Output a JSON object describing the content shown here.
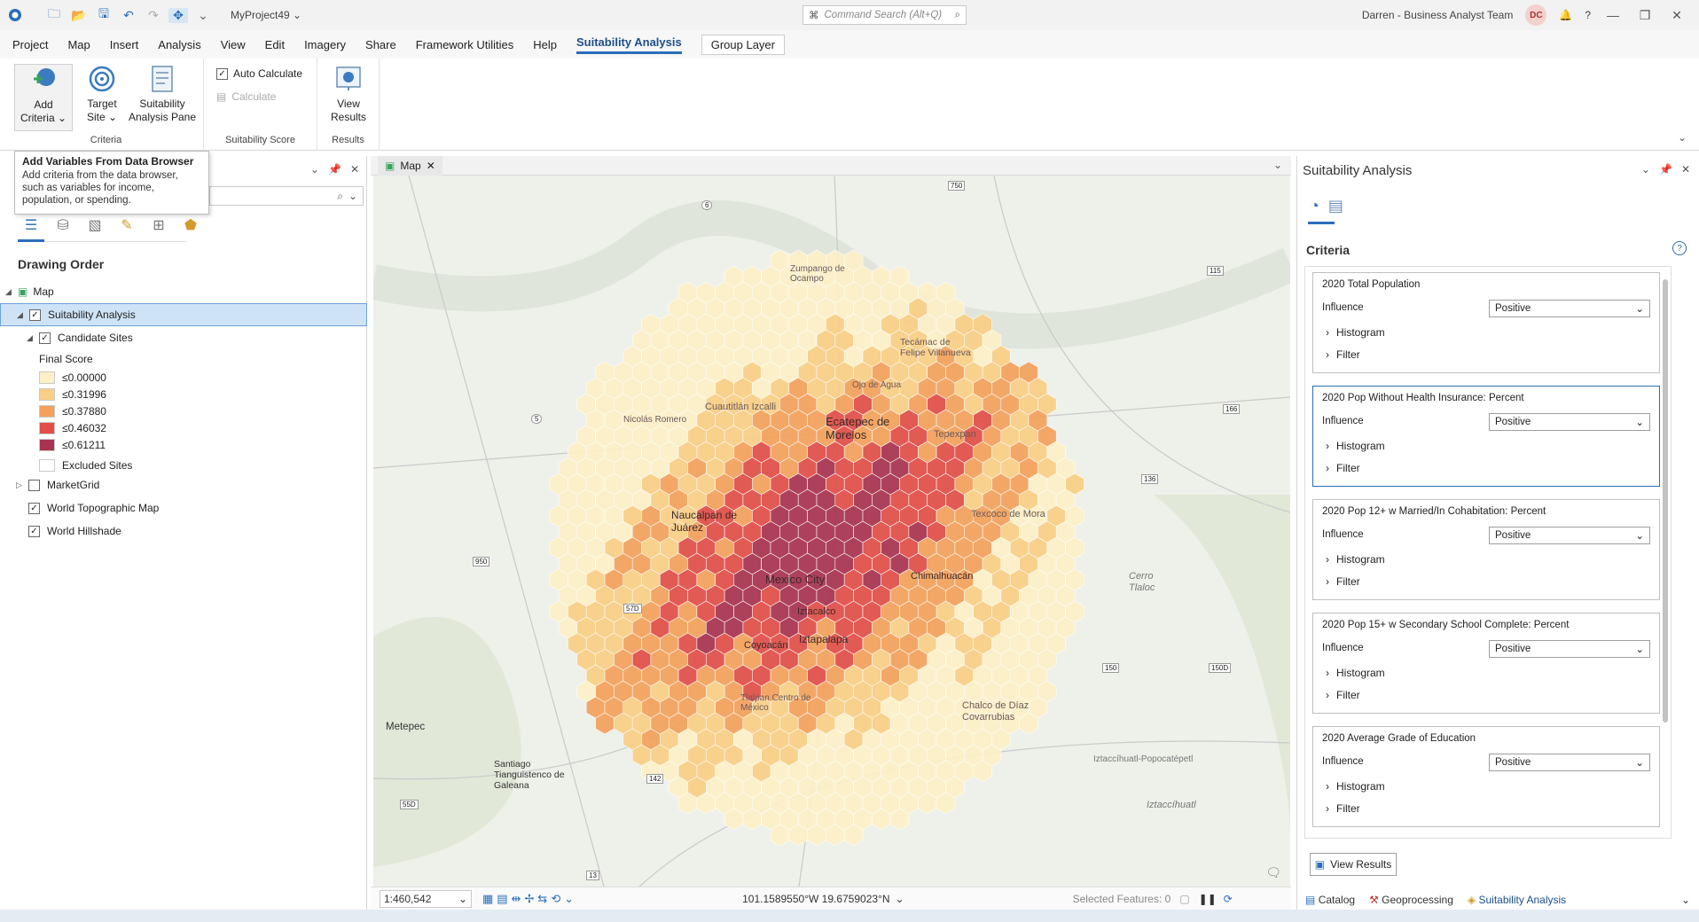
{
  "titlebar": {
    "project_name": "MyProject49 ⌄",
    "search_placeholder": "Command Search (Alt+Q)",
    "user": "Darren - Business Analyst Team",
    "avatar_initials": "DC"
  },
  "menu": {
    "items": [
      "Project",
      "Map",
      "Insert",
      "Analysis",
      "View",
      "Edit",
      "Imagery",
      "Share",
      "Framework Utilities",
      "Help"
    ],
    "active_tab": "Suitability Analysis",
    "context_tab": "Group Layer"
  },
  "ribbon": {
    "add_criteria": "Add",
    "add_criteria2": "Criteria",
    "target_site": "Target",
    "target_site2": "Site",
    "suit_pane": "Suitability",
    "suit_pane2": "Analysis Pane",
    "group_criteria": "Criteria",
    "auto_calc": "Auto Calculate",
    "calculate": "Calculate",
    "group_score": "Suitability Score",
    "view_results": "View",
    "view_results2": "Results",
    "group_results": "Results"
  },
  "tooltip": {
    "title": "Add Variables From Data Browser",
    "body": "Add criteria from the data browser, such as variables for income, population, or spending."
  },
  "contents": {
    "drawing_order": "Drawing Order",
    "map": "Map",
    "suitability": "Suitability Analysis",
    "candidate_sites": "Candidate Sites",
    "final_score": "Final Score",
    "legend": [
      {
        "label": "≤0.00000",
        "color": "#fdf0c8"
      },
      {
        "label": "≤0.31996",
        "color": "#f9cf86"
      },
      {
        "label": "≤0.37880",
        "color": "#f4a15b"
      },
      {
        "label": "≤0.46032",
        "color": "#e24e48"
      },
      {
        "label": "≤0.61211",
        "color": "#a8334f"
      }
    ],
    "excluded": "Excluded Sites",
    "market_grid": "MarketGrid",
    "topo": "World Topographic Map",
    "hillshade": "World Hillshade"
  },
  "map": {
    "tab": "Map",
    "scale": "1:460,542",
    "coords": "101.1589550°W 19.6759023°N",
    "selected": "Selected Features: 0",
    "places": {
      "zumpango": "Zumpango de Ocampo",
      "tecamac": "Tecámac de Felipe Villanueva",
      "ojo": "Ojo de Agua",
      "ecatepec": "Ecatepec de Morelos",
      "cuautitlan": "Cuautitlán Izcalli",
      "nicolas": "Nicolás Romero",
      "tepexpan": "Tepexpan",
      "naucalpan": "Naucalpan de Juárez",
      "texcoco": "Texcoco de Mora",
      "mexico": "Mexico City",
      "chimalhuacan": "Chimalhuacán",
      "iztacalco": "Iztacalco",
      "coyoacan": "Coyoacán",
      "iztapalapa": "Iztapalapa",
      "tlalpan": "Tlalpan Centro de México",
      "chalco": "Chalco de Díaz Covarrubias",
      "metepec": "Metepec",
      "santiago": "Santiago Tianguistenco de Galeana",
      "cerro": "Cerro Tlaloc",
      "izta_popo": "Iztaccíhuatl-Popocatépetl",
      "iztaccihuatl": "Iztaccíhuatl"
    },
    "roads": [
      "750",
      "6",
      "115",
      "5",
      "166",
      "136",
      "950",
      "57D",
      "150",
      "150D",
      "142",
      "55D",
      "13"
    ]
  },
  "suit": {
    "title": "Suitability Analysis",
    "criteria": "Criteria",
    "influence": "Influence",
    "histogram": "Histogram",
    "filter": "Filter",
    "cards": [
      {
        "title": "2020 Total Population",
        "value": "Positive"
      },
      {
        "title": "2020 Pop Without Health Insurance: Percent",
        "value": "Positive"
      },
      {
        "title": "2020 Pop 12+ w Married/In Cohabitation: Percent",
        "value": "Positive"
      },
      {
        "title": "2020 Pop 15+ w Secondary School Complete: Percent",
        "value": "Positive"
      },
      {
        "title": "2020 Average Grade of Education",
        "value": "Positive"
      }
    ],
    "view_results": "View Results"
  },
  "bottom_tabs": [
    "Catalog",
    "Geoprocessing",
    "Suitability Analysis"
  ]
}
